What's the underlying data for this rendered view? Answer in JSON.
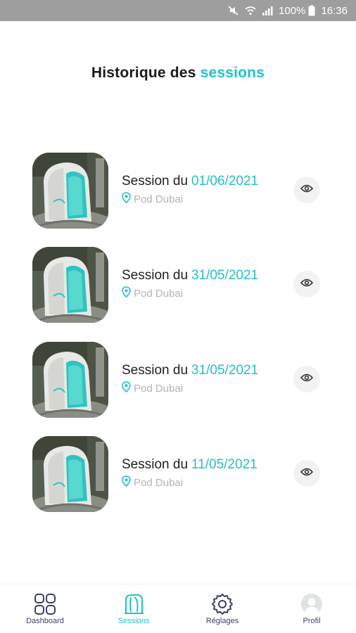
{
  "status_bar": {
    "battery_text": "100%",
    "time": "16:36",
    "icons": [
      "mute-icon",
      "wifi-icon",
      "signal-icon",
      "battery-icon"
    ]
  },
  "header": {
    "title_main": "Historique des",
    "title_accent": "sessions"
  },
  "sessions": [
    {
      "label": "Session du",
      "date": "01/06/2021",
      "location": "Pod Dubai"
    },
    {
      "label": "Session du",
      "date": "31/05/2021",
      "location": "Pod Dubai"
    },
    {
      "label": "Session du",
      "date": "31/05/2021",
      "location": "Pod Dubai"
    },
    {
      "label": "Session du",
      "date": "11/05/2021",
      "location": "Pod Dubai"
    }
  ],
  "nav": {
    "items": [
      {
        "label": "Dashboard",
        "icon": "grid-icon"
      },
      {
        "label": "Sessions",
        "icon": "pod-icon"
      },
      {
        "label": "Réglages",
        "icon": "gear-icon"
      },
      {
        "label": "Profil",
        "icon": "avatar-icon"
      }
    ],
    "active": "Sessions"
  },
  "colors": {
    "accent": "#22bfc7",
    "nav_icon": "#3a3f6b",
    "status_bar": "#9e9e9e"
  }
}
